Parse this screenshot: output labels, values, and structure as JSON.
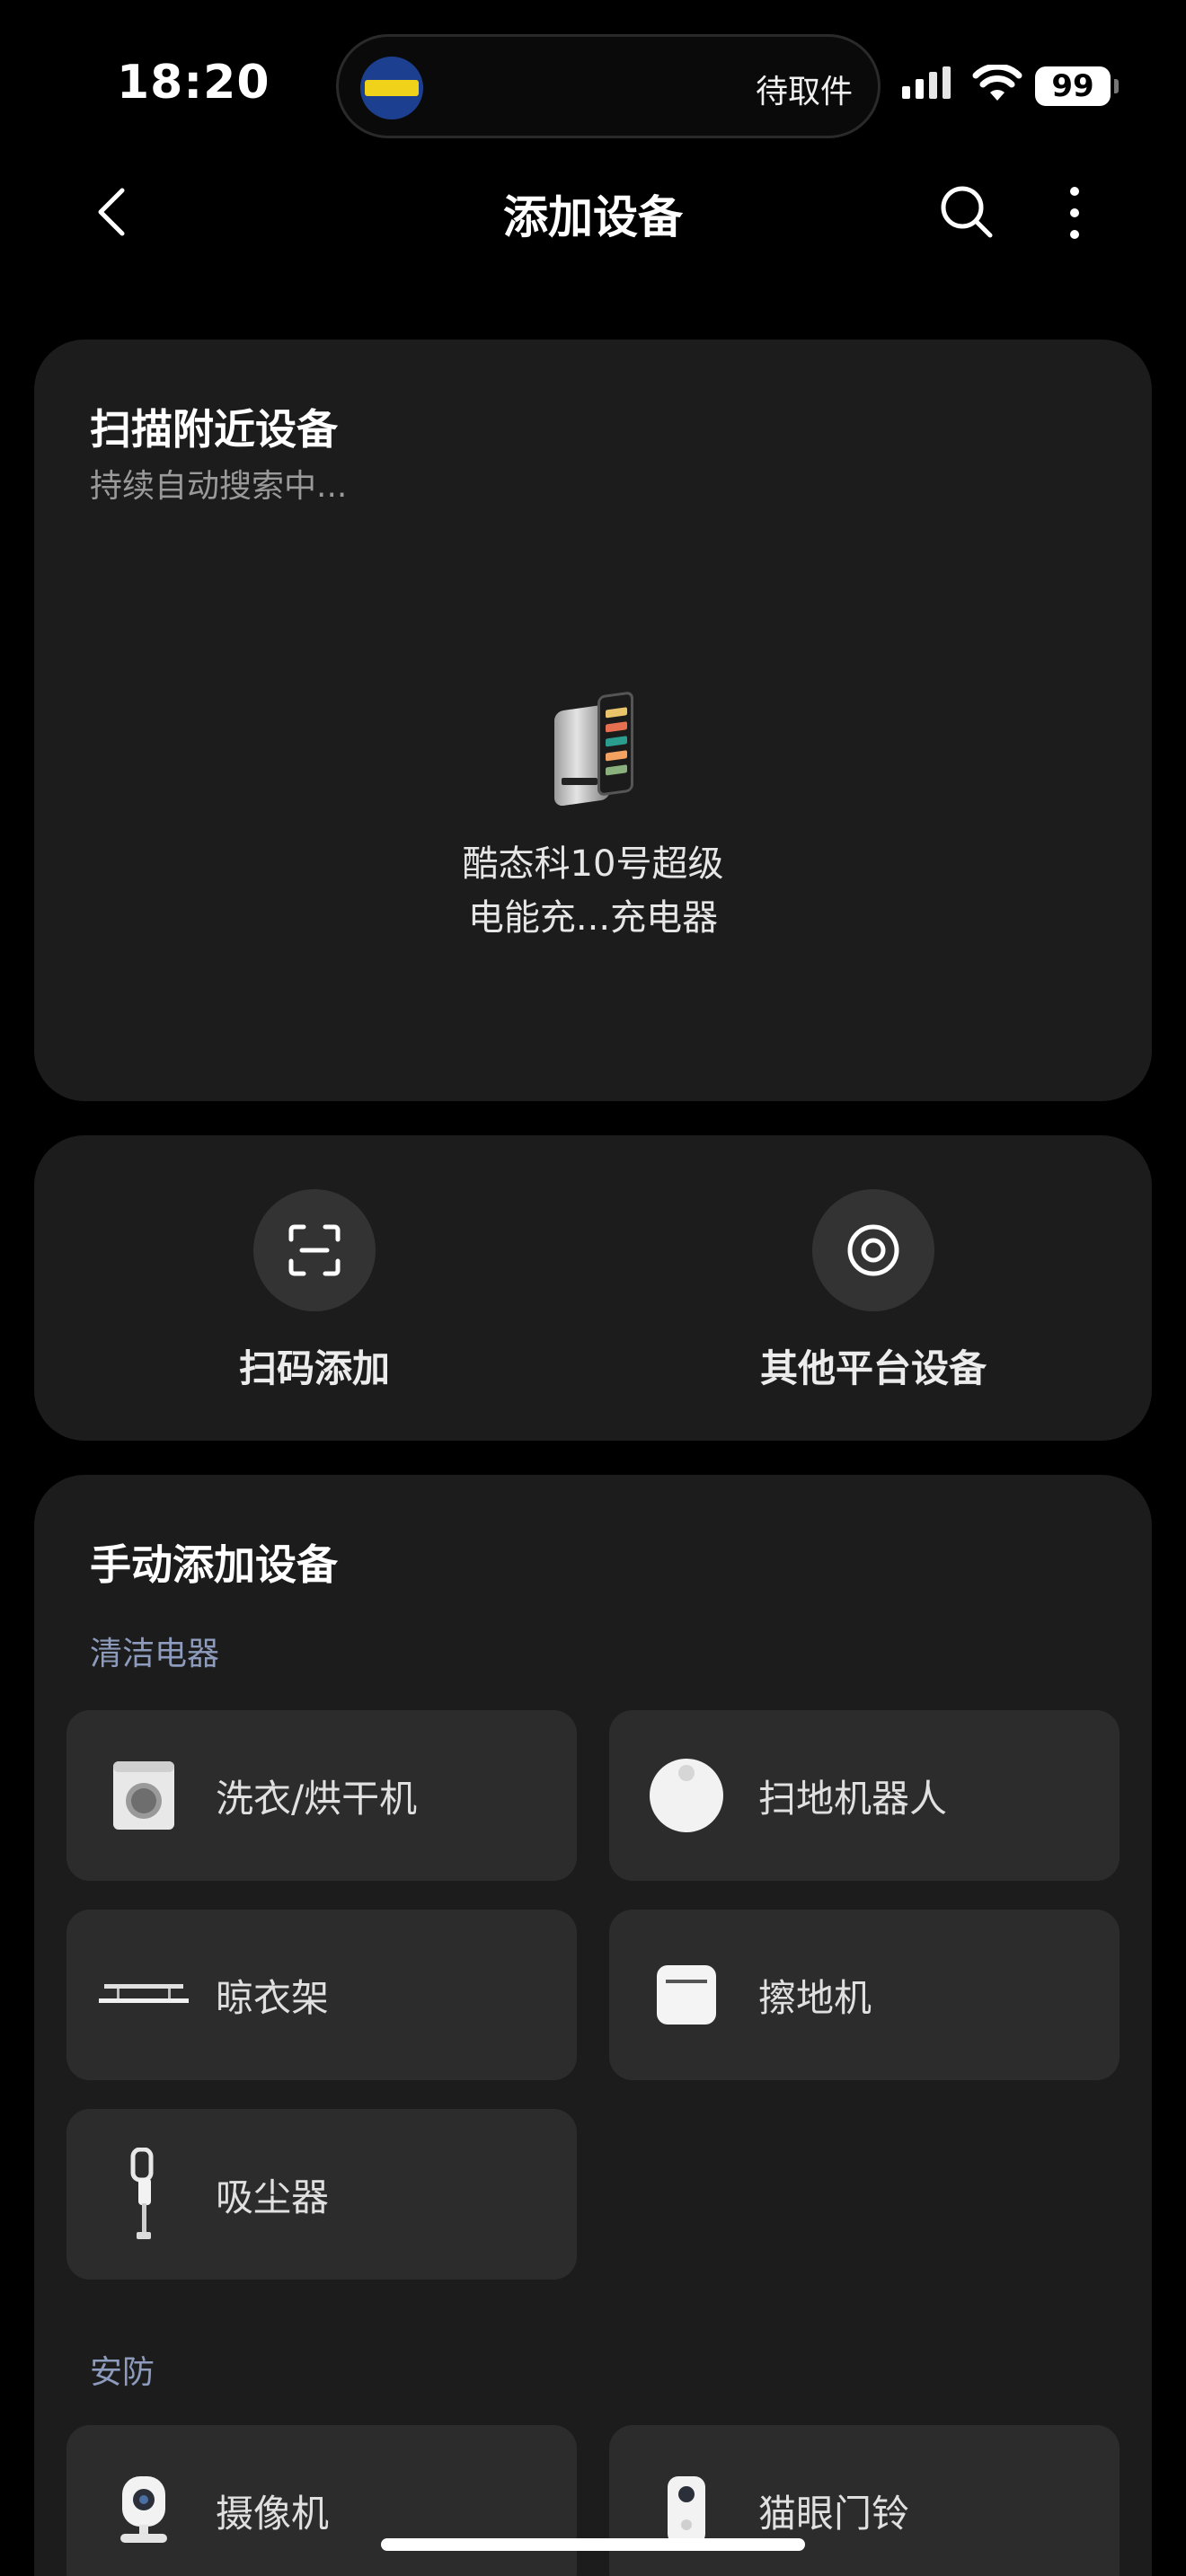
{
  "status_bar": {
    "time": "18:20",
    "island_text": "待取件",
    "battery": "99"
  },
  "header": {
    "title": "添加设备",
    "icons": [
      "back-icon",
      "search-icon",
      "more-icon"
    ]
  },
  "scan_nearby": {
    "title": "扫描附近设备",
    "subtitle": "持续自动搜索中...",
    "device": {
      "name_line1": "酷态科10号超级",
      "name_line2": "电能充...充电器",
      "icon": "charger-icon"
    }
  },
  "actions": [
    {
      "label": "扫码添加",
      "icon": "scan-qr-icon"
    },
    {
      "label": "其他平台设备",
      "icon": "other-platform-icon"
    }
  ],
  "manual": {
    "title": "手动添加设备",
    "sections": [
      {
        "label": "清洁电器",
        "items": [
          {
            "label": "洗衣/烘干机",
            "icon": "washing-machine-icon"
          },
          {
            "label": "扫地机器人",
            "icon": "robot-vacuum-icon"
          },
          {
            "label": "晾衣架",
            "icon": "clothes-rack-icon"
          },
          {
            "label": "擦地机",
            "icon": "floor-scrubber-icon"
          },
          {
            "label": "吸尘器",
            "icon": "vacuum-cleaner-icon"
          }
        ]
      },
      {
        "label": "安防",
        "items": [
          {
            "label": "摄像机",
            "icon": "camera-icon"
          },
          {
            "label": "猫眼门铃",
            "icon": "doorbell-icon"
          }
        ]
      }
    ]
  },
  "colors": {
    "background": "#000000",
    "card": "#1c1c1c",
    "tile": "#2c2c2c",
    "section_label": "#8d9bbd",
    "subtitle": "#9a9a9a"
  }
}
